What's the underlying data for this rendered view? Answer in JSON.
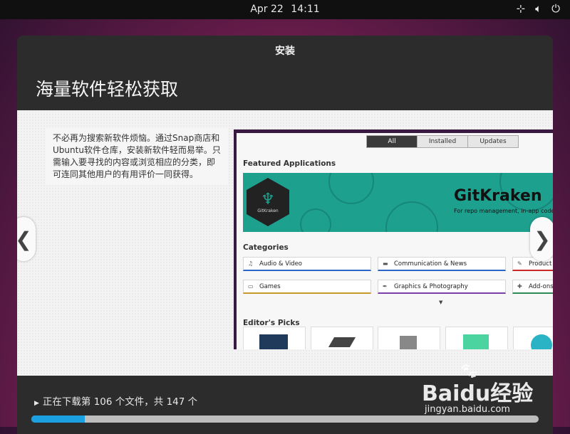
{
  "topbar": {
    "date": "Apr 22",
    "time": "14:11",
    "icons": [
      "network-icon",
      "volume-icon",
      "power-icon"
    ]
  },
  "window": {
    "title": "安装",
    "heading": "海量软件轻松获取"
  },
  "slide": {
    "description": "不必再为搜索新软件烦恼。通过Snap商店和Ubuntu软件仓库，安装新软件轻而易举。只需输入要寻找的内容或浏览相应的分类，即可连同其他用户的有用评价一同获得。",
    "prev_symbol": "❮",
    "next_symbol": "❯"
  },
  "screenshot": {
    "tabs": [
      "All",
      "Installed",
      "Updates"
    ],
    "active_tab": "All",
    "featured_title": "Featured Applications",
    "banner_app": "GitKraken",
    "banner_subtitle": "For repo management, in-app code",
    "banner_logo_label": "GitKraken",
    "categories_title": "Categories",
    "categories": [
      {
        "label": "Audio & Video",
        "icon": "music-icon",
        "color": "#2a64c6"
      },
      {
        "label": "Communication & News",
        "icon": "chat-icon",
        "color": "#2a64c6"
      },
      {
        "label": "Product",
        "icon": "pencil-icon",
        "color": "#c62828"
      },
      {
        "label": "Games",
        "icon": "gamepad-icon",
        "color": "#c69a28"
      },
      {
        "label": "Graphics & Photography",
        "icon": "pen-icon",
        "color": "#7b3fa6"
      },
      {
        "label": "Add-ons",
        "icon": "puzzle-icon",
        "color": "#2e8b57"
      }
    ],
    "editors_title": "Editor's Picks"
  },
  "progress": {
    "text": "正在下载第 106 个文件，共 147 个",
    "current": 106,
    "total": 147,
    "fraction": 0.106
  },
  "watermark": {
    "logo": "Baidu经验",
    "site": "jingyan.baidu.com"
  },
  "colors": {
    "topbar": "#101010",
    "window": "#2c2c2c",
    "progress_fill": "#1ba1e2",
    "progress_track": "#bdbdbd",
    "banner": "#1ea08f"
  }
}
